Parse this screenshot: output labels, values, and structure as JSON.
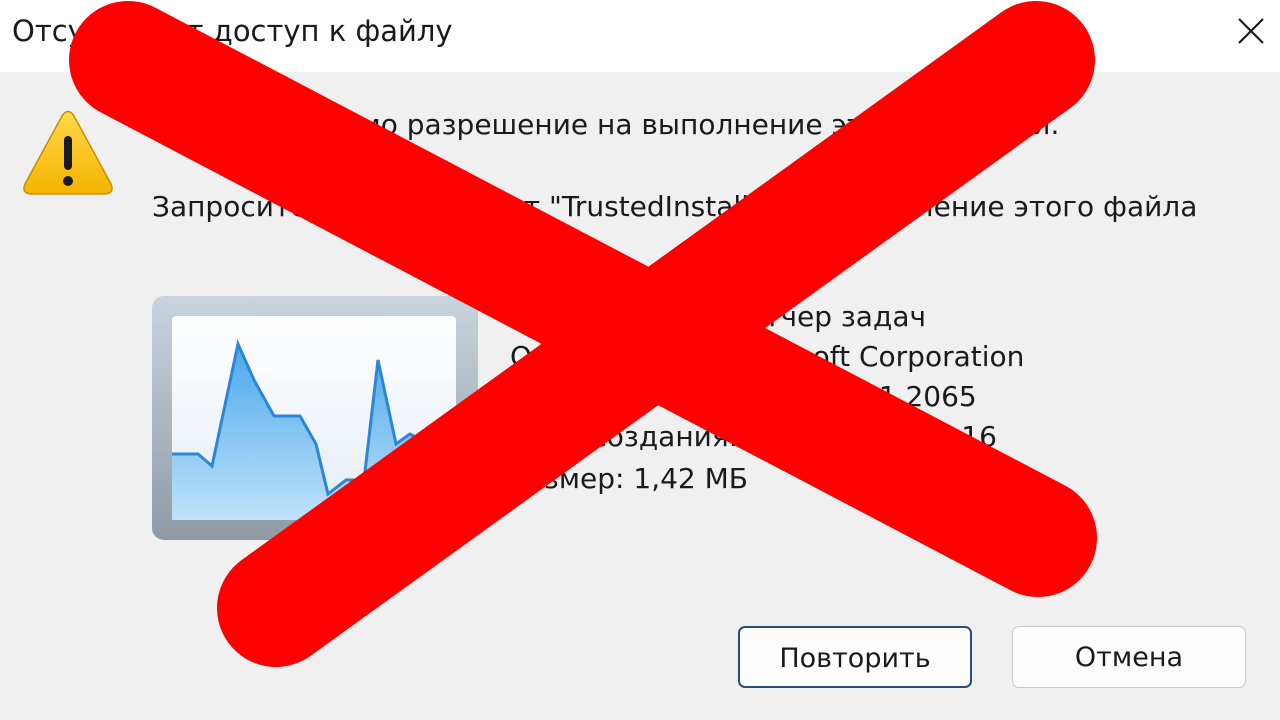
{
  "dialog": {
    "title": "Отсутствует доступ к файлу",
    "close_icon": "close-icon",
    "warning_icon": "warning-icon",
    "message_line1": "Вам необходимо разрешение на выполнение этой операции.",
    "message_line2": "Запросите разрешение от \"TrustedInstaller\" на изменение этого файла",
    "file_icon": "task-manager-icon",
    "file_info": {
      "description": "Описание: Диспетчер задач",
      "company": "Организация: Microsoft Corporation",
      "version": "Версия файла: 10.0.22621.2065",
      "created": "Дата создания: 15.08.2023 21:16",
      "size": "Размер: 1,42 МБ"
    },
    "buttons": {
      "retry": "Повторить",
      "cancel": "Отмена"
    }
  },
  "overlay": {
    "symbol": "red-cross",
    "color": "#ff0000"
  }
}
